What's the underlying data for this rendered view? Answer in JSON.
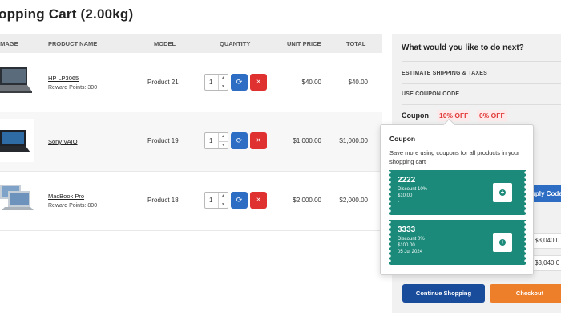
{
  "page": {
    "title": "opping Cart  (2.00kg)"
  },
  "table": {
    "headers": {
      "image": "IMAGE",
      "product": "PRODUCT NAME",
      "model": "MODEL",
      "quantity": "QUANTITY",
      "unit_price": "UNIT PRICE",
      "total": "TOTAL"
    },
    "rows": [
      {
        "name": "HP LP3065",
        "reward": "Reward Points: 300",
        "model": "Product 21",
        "qty": "1",
        "unit": "$40.00",
        "total": "$40.00"
      },
      {
        "name": "Sony VAIO",
        "reward": "",
        "model": "Product 19",
        "qty": "1",
        "unit": "$1,000.00",
        "total": "$1,000.00"
      },
      {
        "name": "MacBook Pro",
        "reward": "Reward Points: 800",
        "model": "Product 18",
        "qty": "1",
        "unit": "$2,000.00",
        "total": "$2,000.00"
      }
    ]
  },
  "sidebar": {
    "title": "What would you like to do next?",
    "estimate": "ESTIMATE SHIPPING & TAXES",
    "use_coupon": "USE COUPON CODE",
    "coupon_label": "Coupon",
    "chips": [
      "10% OFF",
      "0% OFF"
    ],
    "apply": "pply Code",
    "sub_total": "$3,040.0",
    "grand_total": "$3,040.0",
    "continue": "Continue Shopping",
    "checkout": "Checkout"
  },
  "popover": {
    "title": "Coupon",
    "description": "Save more using coupons for all products in your shopping cart",
    "coupons": [
      {
        "code": "2222",
        "discount": "Discount 10%",
        "min": "$10.00",
        "date": "-"
      },
      {
        "code": "3333",
        "discount": "Discount 0%",
        "min": "$100.00",
        "date": "05 Jul 2024"
      }
    ]
  },
  "colors": {
    "blue": "#2d6dc4",
    "red": "#e03131",
    "teal": "#1b8a7a",
    "orange": "#ee7f2a",
    "navy": "#1a4c9c"
  }
}
